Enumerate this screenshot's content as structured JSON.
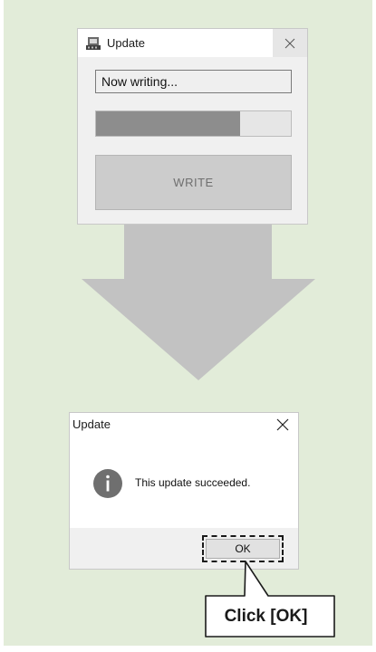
{
  "writing_window": {
    "title": "Update",
    "icon": "device-icon",
    "status_text": "Now writing...",
    "progress": 0.74,
    "write_button_label": "WRITE"
  },
  "success_dialog": {
    "title": "Update",
    "icon": "info-icon",
    "message": "This update succeeded.",
    "ok_label": "OK"
  },
  "callout": {
    "text": "Click [OK]"
  },
  "colors": {
    "panel_background": "#e2ecd9",
    "arrow": "#c2c2c2",
    "progress_fill": "#8d8d8d",
    "info_icon": "#6f6f6f"
  }
}
